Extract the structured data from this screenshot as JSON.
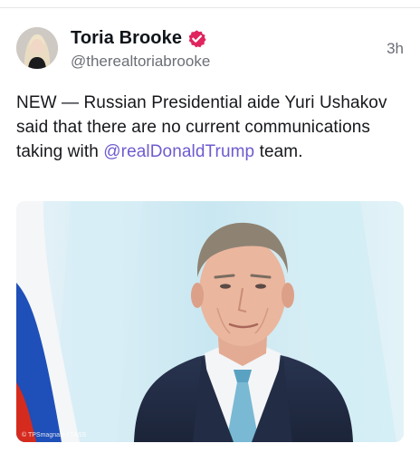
{
  "post": {
    "author": {
      "name": "Toria Brooke",
      "handle": "@therealtoriabrooke",
      "verified_icon": "verified-badge-icon",
      "verified_color": "#e0245e"
    },
    "time": "3h",
    "text_parts": {
      "before_mention": "NEW — Russian Presidential aide Yuri Ushakov said that there are no current communications taking with ",
      "mention": "@realDonaldTrump",
      "after_mention": " team."
    },
    "mention_color": "#6d5bd0",
    "media": {
      "watermark": "© TPSmagnate / TASS"
    }
  }
}
